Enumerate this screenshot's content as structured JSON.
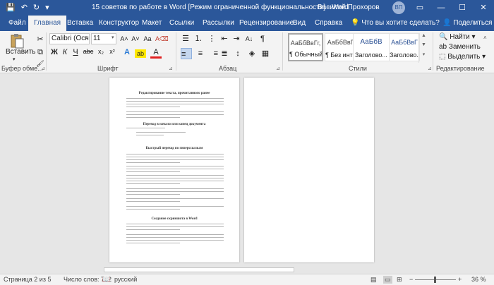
{
  "titlebar": {
    "save_icon": "💾",
    "undo_icon": "↶",
    "redo_icon": "↻",
    "customize_icon": "▾",
    "title": "15 советов по работе в Word [Режим ограниченной функциональности] - Word",
    "user_name": "Василий Прохоров",
    "user_initials": "ВП",
    "ribbon_options_icon": "▭",
    "minimize_icon": "—",
    "maximize_icon": "☐",
    "close_icon": "✕"
  },
  "tabs": [
    {
      "label": "Файл"
    },
    {
      "label": "Главная"
    },
    {
      "label": "Вставка"
    },
    {
      "label": "Конструктор"
    },
    {
      "label": "Макет"
    },
    {
      "label": "Ссылки"
    },
    {
      "label": "Рассылки"
    },
    {
      "label": "Рецензирование"
    },
    {
      "label": "Вид"
    },
    {
      "label": "Справка"
    }
  ],
  "tell_me": {
    "icon": "💡",
    "label": "Что вы хотите сделать?"
  },
  "share": {
    "icon": "👤",
    "label": "Поделиться"
  },
  "clipboard": {
    "paste_label": "Вставить",
    "arrow": "▾",
    "cut_icon": "✂",
    "copy_icon": "⧉",
    "format_painter_icon": "🖌",
    "group_label": "Буфер обме...",
    "launcher": "⊿"
  },
  "font": {
    "font_name": "Calibri (Осн",
    "font_size": "11",
    "grow": "A˄",
    "shrink": "A˅",
    "case": "Aa",
    "clear": "A⌫",
    "bold": "Ж",
    "italic": "К",
    "underline": "Ч",
    "strike": "abc",
    "subscript": "x₂",
    "superscript": "x²",
    "effects": "A",
    "highlight": "ab",
    "color": "A",
    "group_label": "Шрифт",
    "launcher": "⊿",
    "dropdown": "▾"
  },
  "paragraph": {
    "bullets": "☰",
    "numbering": "⒈",
    "multilevel": "⋮",
    "decrease_indent": "⇤",
    "increase_indent": "⇥",
    "sort": "A↓",
    "pilcrow": "¶",
    "align_left": "≡",
    "align_center": "≡",
    "align_right": "≡",
    "justify": "≣",
    "line_spacing": "↕",
    "shading": "◈",
    "borders": "▦",
    "group_label": "Абзац",
    "launcher": "⊿"
  },
  "styles": {
    "items": [
      {
        "sample": "АаБбВвГг,",
        "name": "¶ Обычный"
      },
      {
        "sample": "АаБбВвГг,",
        "name": "¶ Без инте..."
      },
      {
        "sample": "АаБбВ",
        "name": "Заголово..."
      },
      {
        "sample": "АаБбВвГ",
        "name": "Заголово..."
      }
    ],
    "up": "▲",
    "down": "▼",
    "more": "▾",
    "group_label": "Стили",
    "launcher": "⊿"
  },
  "editing": {
    "find": "🔍 Найти",
    "find_arrow": "▾",
    "replace": "ab Заменить",
    "select": "⬚ Выделить",
    "select_arrow": "▾",
    "group_label": "Редактирование",
    "collapse": "˄"
  },
  "document": {
    "page1_headings": [
      "Редактирование текста, прочитанного ранее",
      "Переход в начало или конец документа",
      "Быстрый переход по гиперссылкам",
      "Создание скриншота в Word"
    ]
  },
  "statusbar": {
    "page": "Страница 2 из 5",
    "words": "Число слов: 782",
    "proofing_icon": "📖",
    "language": "русский",
    "read_mode_icon": "▤",
    "print_layout_icon": "▭",
    "web_layout_icon": "⊞",
    "zoom_out": "−",
    "zoom_in": "+",
    "zoom": "36 %"
  }
}
